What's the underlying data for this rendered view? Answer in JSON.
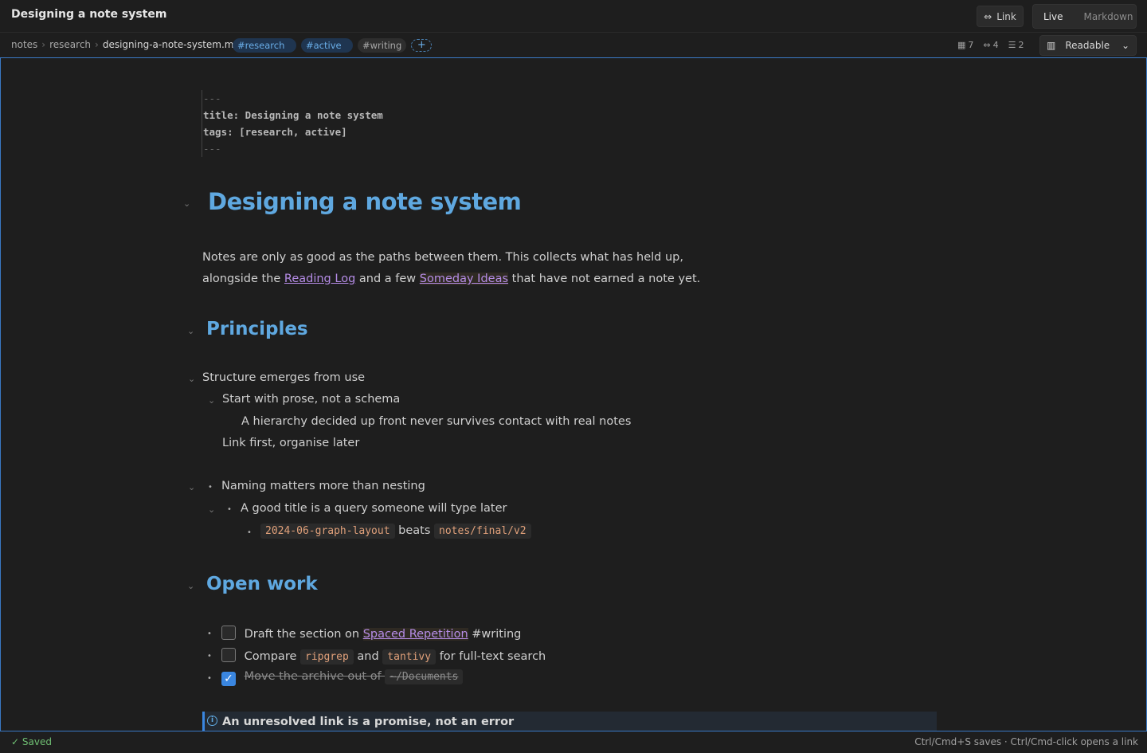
{
  "window": {
    "title": "Designing a note system"
  },
  "toolbar": {
    "link_label": "Link",
    "modes": [
      "Live",
      "Markdown"
    ],
    "active_mode": "Live"
  },
  "breadcrumb": [
    "notes",
    "research",
    "designing-a-note-system.md"
  ],
  "tags": [
    "#research",
    "#active",
    "#writing"
  ],
  "stats": {
    "blocks": "7",
    "links": "4",
    "tasks": "2"
  },
  "view_select": "Readable",
  "frontmatter": {
    "fence": "---",
    "title_line": "title: Designing a note system",
    "tags_line": "tags: [research, active]"
  },
  "doc": {
    "h1": "Designing a note system",
    "intro": {
      "line1": "Notes are only as good as the paths between them. This collects what has held up,",
      "pre": "alongside the ",
      "link1": "Reading Log",
      "mid": " and a few ",
      "link2": "Someday Ideas",
      "post": " that have not earned a note yet."
    },
    "principles": {
      "heading": "Principles",
      "l1": "Structure emerges from use",
      "l2": "Start with prose, not a schema",
      "l3": "A hierarchy decided up front never survives contact with real notes",
      "l4": "Link first, organise later",
      "b1": "Naming matters more than nesting",
      "b2": "A good title is a query someone will type later",
      "b3_code1": "2024-06-graph-layout",
      "b3_mid": "beats",
      "b3_code2": "notes/final/v2"
    },
    "open_work": {
      "heading": "Open work",
      "t1_pre": "Draft the section on ",
      "t1_link": "Spaced Repetition",
      "t1_post": " #writing",
      "t2_pre": "Compare ",
      "t2_code1": "ripgrep",
      "t2_mid": " and ",
      "t2_code2": "tantivy",
      "t2_post": " for full-text search",
      "t3_text": "Move the archive out of ",
      "t3_code": "~/Documents"
    },
    "callout": "An unresolved link is a promise, not an error"
  },
  "status": {
    "saved": "Saved",
    "hint": "Ctrl/Cmd+S saves · Ctrl/Cmd-click opens a link"
  }
}
